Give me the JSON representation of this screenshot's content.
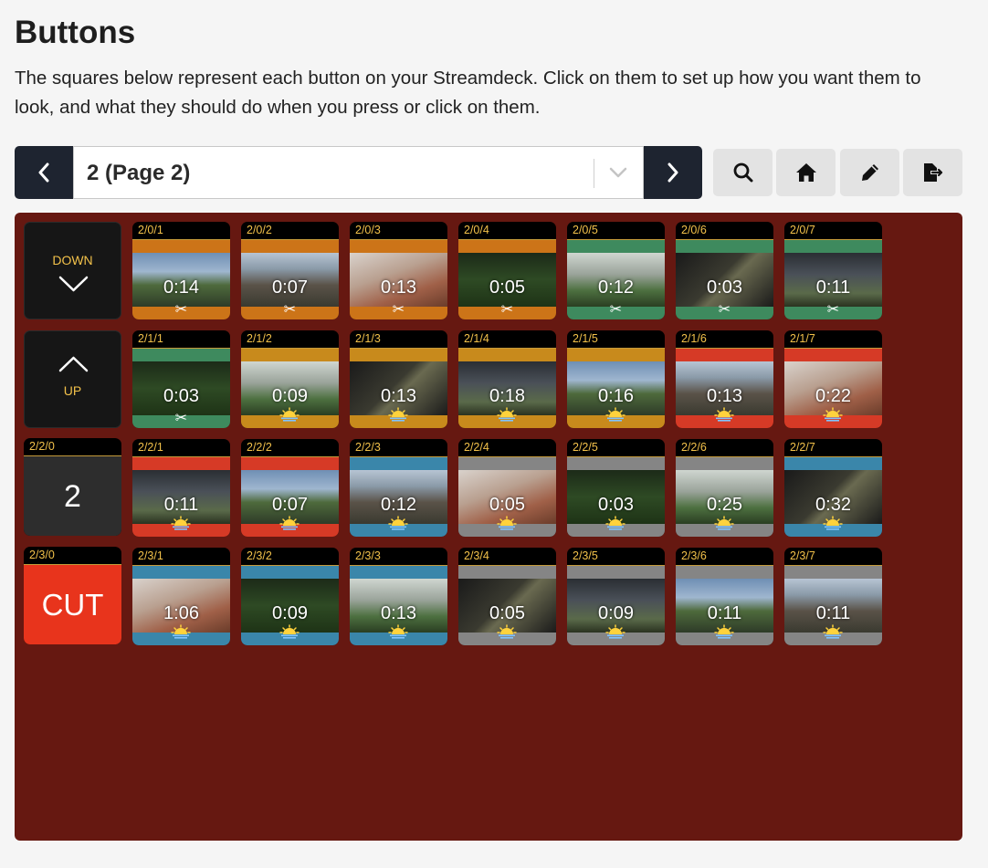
{
  "header": {
    "title": "Buttons",
    "description": "The squares below represent each button on your Streamdeck. Click on them to set up how you want them to look, and what they should do when you press or click on them."
  },
  "pager": {
    "selected": "2 (Page 2)"
  },
  "tools": [
    "search-icon",
    "home-icon",
    "pencil-icon",
    "export-icon"
  ],
  "colors": {
    "panel": "#661811",
    "orange": "#cc7418",
    "green": "#3e8a5e",
    "yellow": "#c88a1c",
    "red": "#d63a26",
    "blue": "#3a86aa",
    "gray": "#858585",
    "cut": "#e8341c"
  },
  "nav_buttons": {
    "down": "DOWN",
    "up": "UP",
    "page_label": "2/2/0",
    "page_number": "2",
    "cut_label": "2/3/0",
    "cut_text": "CUT"
  },
  "rows": [
    [
      {
        "label": "2/0/1",
        "time": "0:14",
        "color": "orange",
        "glyph": "✂"
      },
      {
        "label": "2/0/2",
        "time": "0:07",
        "color": "orange",
        "glyph": "✂"
      },
      {
        "label": "2/0/3",
        "time": "0:13",
        "color": "orange",
        "glyph": "✂"
      },
      {
        "label": "2/0/4",
        "time": "0:05",
        "color": "orange",
        "glyph": "✂"
      },
      {
        "label": "2/0/5",
        "time": "0:12",
        "color": "green",
        "glyph": "✂"
      },
      {
        "label": "2/0/6",
        "time": "0:03",
        "color": "green",
        "glyph": "✂"
      },
      {
        "label": "2/0/7",
        "time": "0:11",
        "color": "green",
        "glyph": "✂"
      }
    ],
    [
      {
        "label": "2/1/1",
        "time": "0:03",
        "color": "green",
        "glyph": "✂"
      },
      {
        "label": "2/1/2",
        "time": "0:09",
        "color": "yellow",
        "glyph": "sun"
      },
      {
        "label": "2/1/3",
        "time": "0:13",
        "color": "yellow",
        "glyph": "sun"
      },
      {
        "label": "2/1/4",
        "time": "0:18",
        "color": "yellow",
        "glyph": "sun"
      },
      {
        "label": "2/1/5",
        "time": "0:16",
        "color": "yellow",
        "glyph": "sun"
      },
      {
        "label": "2/1/6",
        "time": "0:13",
        "color": "red",
        "glyph": "sun"
      },
      {
        "label": "2/1/7",
        "time": "0:22",
        "color": "red",
        "glyph": "sun"
      }
    ],
    [
      {
        "label": "2/2/1",
        "time": "0:11",
        "color": "red",
        "glyph": "sun"
      },
      {
        "label": "2/2/2",
        "time": "0:07",
        "color": "red",
        "glyph": "sun"
      },
      {
        "label": "2/2/3",
        "time": "0:12",
        "color": "blue",
        "glyph": "sun"
      },
      {
        "label": "2/2/4",
        "time": "0:05",
        "color": "gray",
        "glyph": "sun"
      },
      {
        "label": "2/2/5",
        "time": "0:03",
        "color": "gray",
        "glyph": "sun"
      },
      {
        "label": "2/2/6",
        "time": "0:25",
        "color": "gray",
        "glyph": "sun"
      },
      {
        "label": "2/2/7",
        "time": "0:32",
        "color": "blue",
        "glyph": "sun"
      }
    ],
    [
      {
        "label": "2/3/1",
        "time": "1:06",
        "color": "blue",
        "glyph": "sun"
      },
      {
        "label": "2/3/2",
        "time": "0:09",
        "color": "blue",
        "glyph": "sun"
      },
      {
        "label": "2/3/3",
        "time": "0:13",
        "color": "blue",
        "glyph": "sun"
      },
      {
        "label": "2/3/4",
        "time": "0:05",
        "color": "gray",
        "glyph": "sun"
      },
      {
        "label": "2/3/5",
        "time": "0:09",
        "color": "gray",
        "glyph": "sun"
      },
      {
        "label": "2/3/6",
        "time": "0:11",
        "color": "gray",
        "glyph": "sun"
      },
      {
        "label": "2/3/7",
        "time": "0:11",
        "color": "gray",
        "glyph": "sun"
      }
    ]
  ]
}
